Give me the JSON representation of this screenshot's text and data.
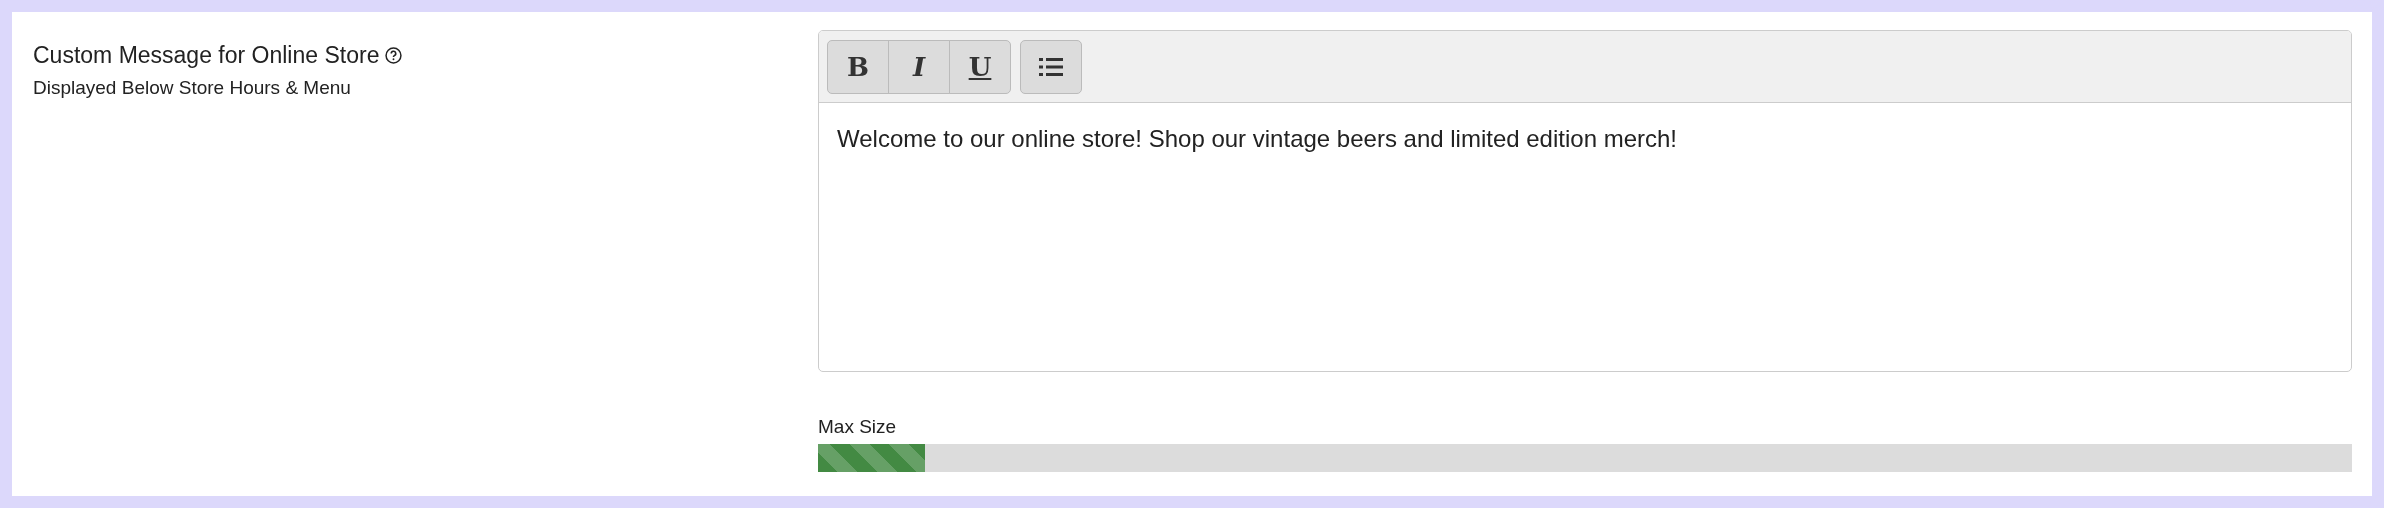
{
  "field": {
    "label": "Custom Message for Online Store",
    "hint": "Displayed Below Store Hours & Menu"
  },
  "editor": {
    "format_buttons": [
      {
        "label": "B",
        "kind": "bold"
      },
      {
        "label": "I",
        "kind": "italic"
      },
      {
        "label": "U",
        "kind": "underline"
      }
    ],
    "value": "Welcome to our online store! Shop our vintage beers and limited edition merch!"
  },
  "max_size": {
    "label": "Max Size",
    "level": 0.07
  }
}
